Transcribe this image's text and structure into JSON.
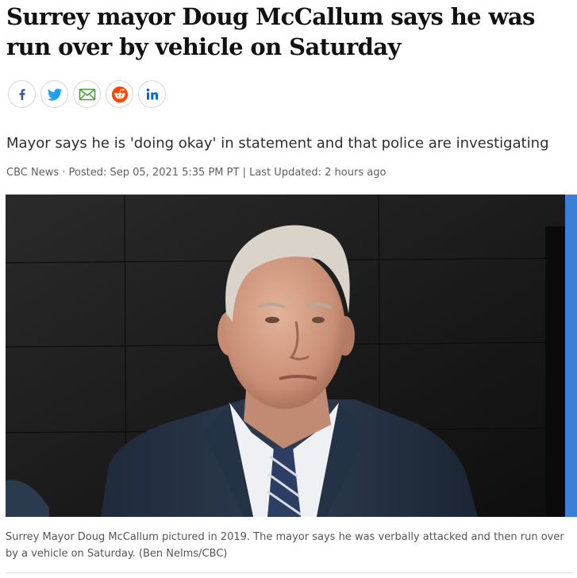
{
  "article": {
    "headline": "Surrey mayor Doug McCallum says he was run over by vehicle on Saturday",
    "deck": "Mayor says he is 'doing okay' in statement and that police are investigating",
    "byline": {
      "source": "CBC News",
      "separator": " · ",
      "posted": "Posted: Sep 05, 2021 5:35 PM PT",
      "divider": " | ",
      "updated": "Last Updated: 2 hours ago"
    },
    "photo": {
      "caption": "Surrey Mayor Doug McCallum pictured in 2019. The mayor says he was verbally attacked and then run over by a vehicle on Saturday. (Ben Nelms/CBC)"
    }
  },
  "share": {
    "buttons": [
      {
        "icon": "facebook-icon",
        "color": "#3b5998"
      },
      {
        "icon": "twitter-icon",
        "color": "#1da1f2"
      },
      {
        "icon": "email-icon",
        "color": "#4a9a3a"
      },
      {
        "icon": "reddit-icon",
        "color": "#ff4500"
      },
      {
        "icon": "linkedin-icon",
        "color": "#0a66c2"
      }
    ]
  }
}
